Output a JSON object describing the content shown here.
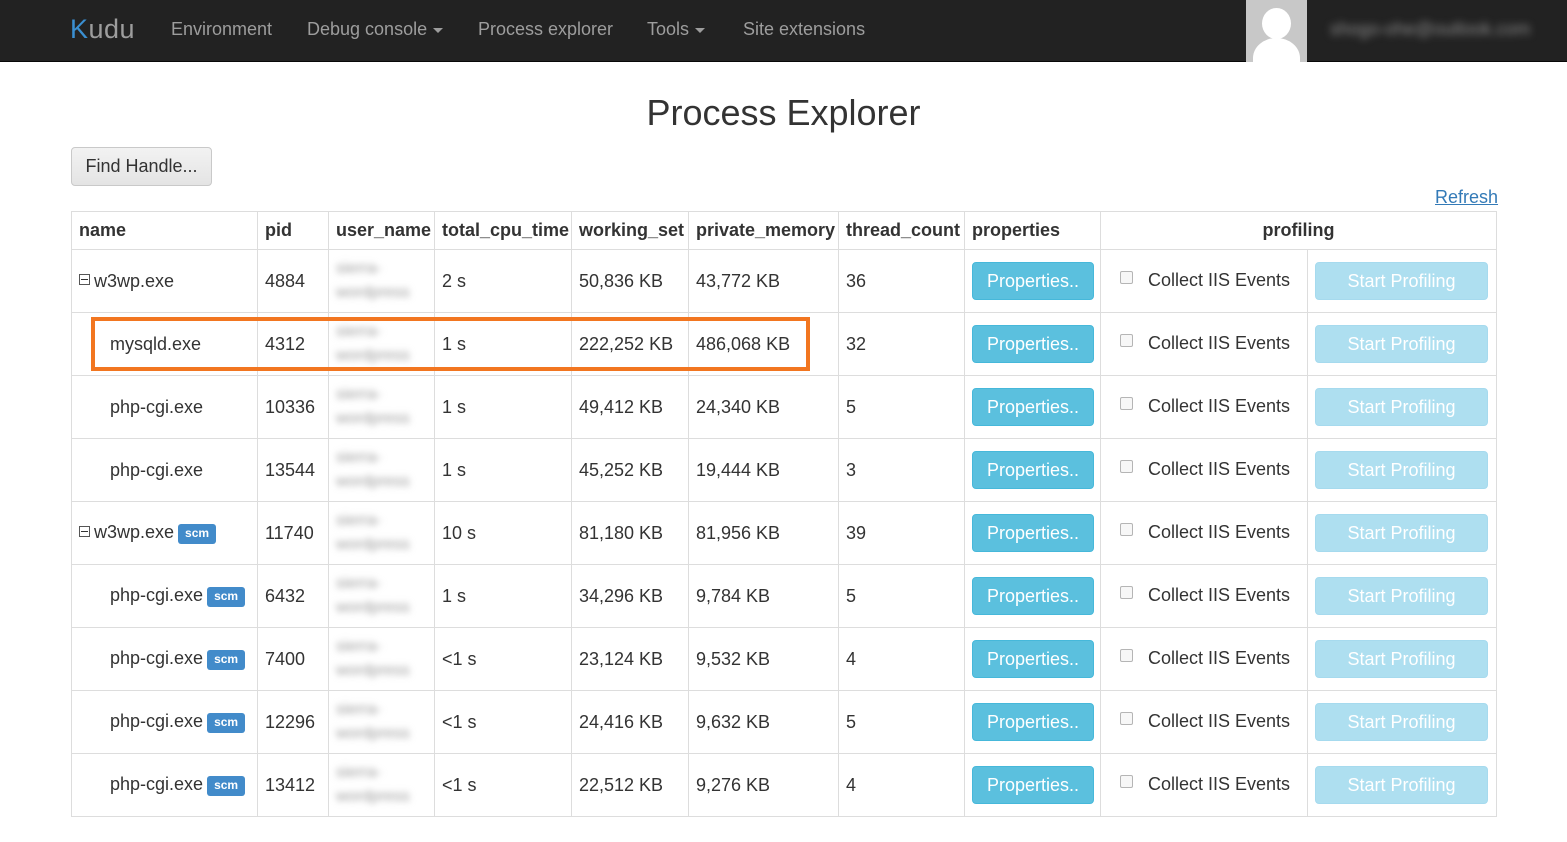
{
  "nav": {
    "brand_k": "K",
    "brand_rest": "udu",
    "items": [
      "Environment",
      "Debug console",
      "Process explorer",
      "Tools",
      "Site extensions"
    ],
    "user_email": "shogo-ohe@outlook.com"
  },
  "page": {
    "title": "Process Explorer",
    "find_handle": "Find Handle...",
    "refresh": "Refresh"
  },
  "table": {
    "headers": [
      "name",
      "pid",
      "user_name",
      "total_cpu_time",
      "working_set",
      "private_memory",
      "thread_count",
      "properties",
      "profiling"
    ],
    "props_label": "Properties..",
    "iis_label": "Collect IIS Events",
    "profile_label": "Start Profiling",
    "user_line1": "sierra-",
    "user_line2": "wordpress",
    "scm_label": "scm",
    "rows": [
      {
        "name": "w3wp.exe",
        "pid": "4884",
        "cpu": "2 s",
        "ws": "50,836 KB",
        "pm": "43,772 KB",
        "tc": "36"
      },
      {
        "name": "mysqld.exe",
        "pid": "4312",
        "cpu": "1 s",
        "ws": "222,252 KB",
        "pm": "486,068 KB",
        "tc": "32"
      },
      {
        "name": "php-cgi.exe",
        "pid": "10336",
        "cpu": "1 s",
        "ws": "49,412 KB",
        "pm": "24,340 KB",
        "tc": "5"
      },
      {
        "name": "php-cgi.exe",
        "pid": "13544",
        "cpu": "1 s",
        "ws": "45,252 KB",
        "pm": "19,444 KB",
        "tc": "3"
      },
      {
        "name": "w3wp.exe",
        "pid": "11740",
        "cpu": "10 s",
        "ws": "81,180 KB",
        "pm": "81,956 KB",
        "tc": "39"
      },
      {
        "name": "php-cgi.exe",
        "pid": "6432",
        "cpu": "1 s",
        "ws": "34,296 KB",
        "pm": "9,784 KB",
        "tc": "5"
      },
      {
        "name": "php-cgi.exe",
        "pid": "7400",
        "cpu": "<1 s",
        "ws": "23,124 KB",
        "pm": "9,532 KB",
        "tc": "4"
      },
      {
        "name": "php-cgi.exe",
        "pid": "12296",
        "cpu": "<1 s",
        "ws": "24,416 KB",
        "pm": "9,632 KB",
        "tc": "5"
      },
      {
        "name": "php-cgi.exe",
        "pid": "13412",
        "cpu": "<1 s",
        "ws": "22,512 KB",
        "pm": "9,276 KB",
        "tc": "4"
      }
    ]
  },
  "colors": {
    "navbar": "#222222",
    "info_button": "#5bc0de",
    "scm_badge": "#428bca",
    "highlight_box": "#f27620"
  }
}
